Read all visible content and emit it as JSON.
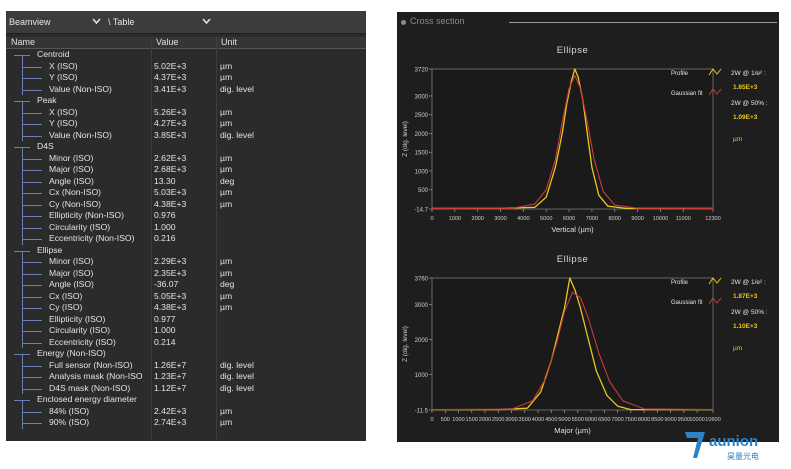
{
  "left_panel": {
    "view_combo": "Beamview",
    "mode_combo": "\\ Table",
    "columns": [
      "Name",
      "Value",
      "Unit"
    ],
    "rows": [
      {
        "level": 0,
        "name": "Centroid",
        "value": "",
        "unit": ""
      },
      {
        "level": 1,
        "name": "X (ISO)",
        "value": "5.02E+3",
        "unit": "µm"
      },
      {
        "level": 1,
        "name": "Y (ISO)",
        "value": "4.37E+3",
        "unit": "µm"
      },
      {
        "level": 1,
        "name": "Value (Non-ISO)",
        "value": "3.41E+3",
        "unit": "dig. level"
      },
      {
        "level": 0,
        "name": "Peak",
        "value": "",
        "unit": ""
      },
      {
        "level": 1,
        "name": "X (ISO)",
        "value": "5.26E+3",
        "unit": "µm"
      },
      {
        "level": 1,
        "name": "Y (ISO)",
        "value": "4.27E+3",
        "unit": "µm"
      },
      {
        "level": 1,
        "name": "Value (Non-ISO)",
        "value": "3.85E+3",
        "unit": "dig. level"
      },
      {
        "level": 0,
        "name": "D4S",
        "value": "",
        "unit": ""
      },
      {
        "level": 1,
        "name": "Minor (ISO)",
        "value": "2.62E+3",
        "unit": "µm"
      },
      {
        "level": 1,
        "name": "Major (ISO)",
        "value": "2.68E+3",
        "unit": "µm"
      },
      {
        "level": 1,
        "name": "Angle (ISO)",
        "value": "13.30",
        "unit": "deg"
      },
      {
        "level": 1,
        "name": "Cx (Non-ISO)",
        "value": "5.03E+3",
        "unit": "µm"
      },
      {
        "level": 1,
        "name": "Cy (Non-ISO)",
        "value": "4.38E+3",
        "unit": "µm"
      },
      {
        "level": 1,
        "name": "Ellipticity (Non-ISO)",
        "value": "0.976",
        "unit": ""
      },
      {
        "level": 1,
        "name": "Circularity (ISO)",
        "value": "1.000",
        "unit": ""
      },
      {
        "level": 1,
        "name": "Eccentricity (Non-ISO)",
        "value": "0.216",
        "unit": ""
      },
      {
        "level": 0,
        "name": "Ellipse",
        "value": "",
        "unit": ""
      },
      {
        "level": 1,
        "name": "Minor (ISO)",
        "value": "2.29E+3",
        "unit": "µm"
      },
      {
        "level": 1,
        "name": "Major (ISO)",
        "value": "2.35E+3",
        "unit": "µm"
      },
      {
        "level": 1,
        "name": "Angle (ISO)",
        "value": "-36.07",
        "unit": "deg"
      },
      {
        "level": 1,
        "name": "Cx (ISO)",
        "value": "5.05E+3",
        "unit": "µm"
      },
      {
        "level": 1,
        "name": "Cy (ISO)",
        "value": "4.38E+3",
        "unit": "µm"
      },
      {
        "level": 1,
        "name": "Ellipticity (ISO)",
        "value": "0.977",
        "unit": ""
      },
      {
        "level": 1,
        "name": "Circularity (ISO)",
        "value": "1.000",
        "unit": ""
      },
      {
        "level": 1,
        "name": "Eccentricity (ISO)",
        "value": "0.214",
        "unit": ""
      },
      {
        "level": 0,
        "name": "Energy (Non-ISO)",
        "value": "",
        "unit": ""
      },
      {
        "level": 1,
        "name": "Full sensor (Non-ISO)",
        "value": "1.26E+7",
        "unit": "dig. level"
      },
      {
        "level": 1,
        "name": "Analysis mask (Non-ISO",
        "value": "1.23E+7",
        "unit": "dig. level"
      },
      {
        "level": 1,
        "name": "D4S mask (Non-ISO)",
        "value": "1.12E+7",
        "unit": "dig. level"
      },
      {
        "level": 0,
        "name": "Enclosed energy diameter",
        "value": "",
        "unit": ""
      },
      {
        "level": 1,
        "name": "84% (ISO)",
        "value": "2.42E+3",
        "unit": "µm"
      },
      {
        "level": 1,
        "name": "90% (ISO)",
        "value": "2.74E+3",
        "unit": "µm"
      }
    ]
  },
  "right_panel": {
    "title": "Cross section",
    "legend": {
      "profile": "Profile",
      "gaussian": "Gaussian fit"
    },
    "colors": {
      "profile": "#e8c81e",
      "gaussian": "#c83c3c",
      "value": "#e8c81e"
    }
  },
  "chart_data": [
    {
      "type": "line",
      "title": "Ellipse",
      "xlabel": "Vertical (µm)",
      "ylabel": "Z (dig. level)",
      "xlim": [
        0,
        12300
      ],
      "ylim": [
        -14.7,
        3720
      ],
      "xticks": [
        "0",
        "1000",
        "2000",
        "3000",
        "4000",
        "5000",
        "6000",
        "7000",
        "8000",
        "9000",
        "10000",
        "11000",
        "12300"
      ],
      "yticks": [
        "3720",
        "3000",
        "2500",
        "2000",
        "1500",
        "1000",
        "500",
        "-14.7"
      ],
      "series": [
        {
          "name": "Profile",
          "x": [
            0,
            3000,
            4500,
            5000,
            5400,
            5700,
            5900,
            6100,
            6250,
            6400,
            6600,
            6800,
            7000,
            7300,
            7700,
            8500,
            12300
          ],
          "y": [
            0,
            0,
            30,
            300,
            1100,
            2000,
            2800,
            3400,
            3720,
            3500,
            2900,
            2000,
            1100,
            350,
            60,
            0,
            0
          ]
        },
        {
          "name": "Gaussian fit",
          "x": [
            0,
            3500,
            4500,
            5000,
            5400,
            5700,
            6000,
            6250,
            6500,
            6800,
            7100,
            7500,
            8000,
            9000,
            12300
          ],
          "y": [
            0,
            5,
            120,
            500,
            1300,
            2300,
            3200,
            3550,
            3200,
            2300,
            1300,
            450,
            90,
            5,
            0
          ]
        }
      ],
      "annotations": {
        "w_1e2_label": "2W @ 1/e² :",
        "w_1e2_value": "1.85E+3",
        "w_50_label": "2W @ 50% :",
        "w_50_value": "1.09E+3",
        "unit": "µm"
      }
    },
    {
      "type": "line",
      "title": "Ellipse",
      "xlabel": "Major (µm)",
      "ylabel": "Z (dig. level)",
      "xlim": [
        0,
        10600
      ],
      "ylim": [
        -11.5,
        3760
      ],
      "xticks": [
        "0",
        "500",
        "1000",
        "1500",
        "2000",
        "2500",
        "3000",
        "3500",
        "4000",
        "4500",
        "5000",
        "5500",
        "6000",
        "6500",
        "7000",
        "7500",
        "8000",
        "8500",
        "9000",
        "9500",
        "10000",
        "10600"
      ],
      "yticks": [
        "3760",
        "3000",
        "2000",
        "1000",
        "-11.5"
      ],
      "series": [
        {
          "name": "Profile",
          "x": [
            0,
            2500,
            3600,
            4100,
            4500,
            4800,
            5000,
            5200,
            5400,
            5600,
            5900,
            6200,
            6600,
            7000,
            7500,
            10600
          ],
          "y": [
            0,
            0,
            40,
            500,
            1400,
            2300,
            2900,
            3760,
            3400,
            2900,
            2000,
            1100,
            400,
            100,
            0,
            0
          ]
        },
        {
          "name": "Gaussian fit",
          "x": [
            0,
            3000,
            3800,
            4300,
            4700,
            5000,
            5300,
            5600,
            5900,
            6300,
            6700,
            7200,
            8000,
            10600
          ],
          "y": [
            0,
            10,
            250,
            900,
            1900,
            2800,
            3350,
            3200,
            2600,
            1600,
            800,
            250,
            20,
            0
          ]
        }
      ],
      "annotations": {
        "w_1e2_label": "2W @ 1/e² :",
        "w_1e2_value": "1.87E+3",
        "w_50_label": "2W @ 50% :",
        "w_50_value": "1.10E+3",
        "unit": "µm"
      }
    }
  ],
  "logo": {
    "text": "aunion",
    "subtext": "昊量光电",
    "color": "#2a82c8"
  }
}
